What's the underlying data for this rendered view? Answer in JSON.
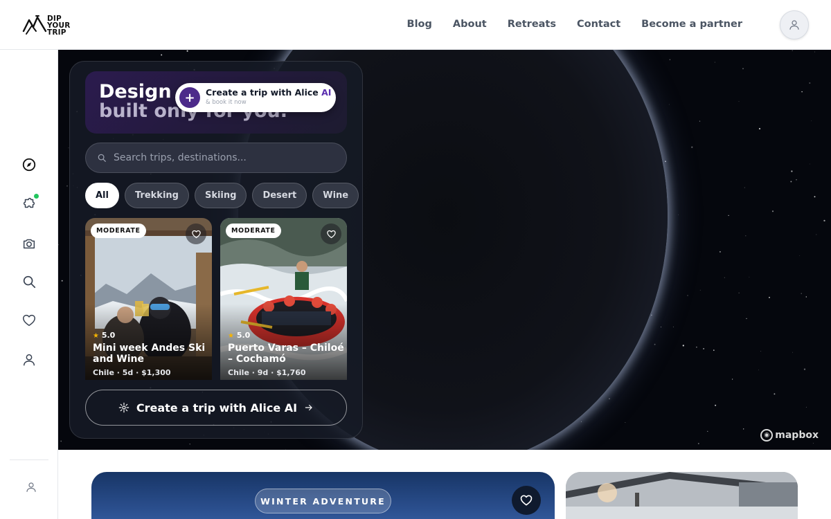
{
  "brand": {
    "logo_text": [
      "DIP",
      "YOUR",
      "TRIP"
    ]
  },
  "nav": {
    "items": [
      "Blog",
      "About",
      "Retreats",
      "Contact",
      "Become a partner"
    ]
  },
  "sidebar": {
    "icons": [
      "compass-icon",
      "puzzle-icon",
      "camera-icon",
      "search-icon",
      "heart-icon",
      "user-icon"
    ],
    "bottom_icon": "user-icon"
  },
  "hero": {
    "line1": "Design a",
    "line2": "built only for you."
  },
  "alice_pill": {
    "title_prefix": "Create a trip with Alice",
    "title_ai": "AI",
    "subtitle": "& book it now"
  },
  "search": {
    "placeholder": "Search trips, destinations..."
  },
  "filters": {
    "chips": [
      "All",
      "Trekking",
      "Skiing",
      "Desert",
      "Wine"
    ],
    "active": "All"
  },
  "trips": [
    {
      "badge": "MODERATE",
      "rating": "5.0",
      "title": "Mini week Andes Ski and Wine",
      "meta": "Chile · 5d · $1,300"
    },
    {
      "badge": "MODERATE",
      "rating": "5.0",
      "title": "Puerto Varas – Chiloé – Cochamó",
      "meta": "Chile · 9d · $1,760"
    }
  ],
  "cta": {
    "label": "Create a trip with Alice AI"
  },
  "map": {
    "attribution": "mapbox"
  },
  "featured": {
    "chip": "WINTER ADVENTURE"
  },
  "colors": {
    "accent_purple": "#4c2a8a",
    "map_bg": "#05070d",
    "winter_blue": "#2b4f8e"
  }
}
